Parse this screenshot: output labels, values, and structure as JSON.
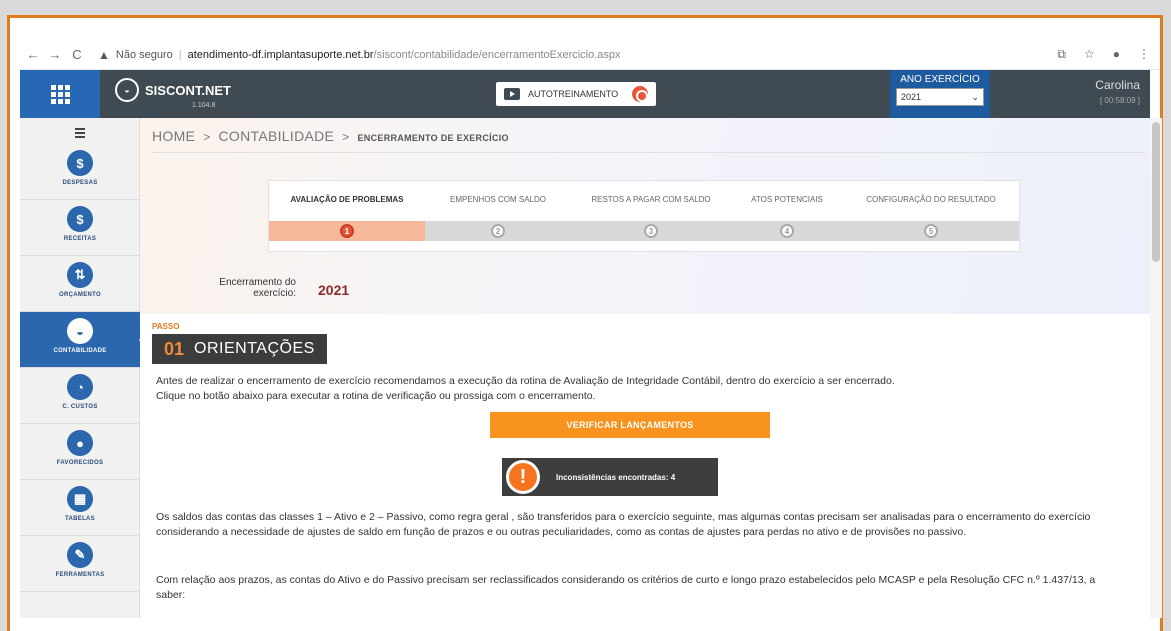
{
  "browser": {
    "security_label": "Não seguro",
    "url_host": "atendimento-df.implantasuporte.net.br",
    "url_path": "/siscont/contabilidade/encerramentoExercicio.aspx"
  },
  "topbar": {
    "app_name": "SISCONT.NET",
    "version": "1.104.8",
    "autotreinamento_label": "AUTOTREINAMENTO",
    "ano_exercicio_label": "ANO EXERCÍCIO",
    "ano_exercicio_value": "2021",
    "user_name": "Carolina",
    "session_timer": "[ 00:58:09 ]"
  },
  "sidebar": {
    "items": [
      {
        "label": "DESPESAS",
        "glyph": "$",
        "icon": "money-icon"
      },
      {
        "label": "RECEITAS",
        "glyph": "$",
        "icon": "money-icon"
      },
      {
        "label": "ORÇAMENTO",
        "glyph": "⇅",
        "icon": "transfer-icon"
      },
      {
        "label": "CONTABILIDADE",
        "glyph": "◒",
        "icon": "hand-coin-icon"
      },
      {
        "label": "C. CUSTOS",
        "glyph": "◔",
        "icon": "pie-icon"
      },
      {
        "label": "FAVORECIDOS",
        "glyph": "●",
        "icon": "user-icon"
      },
      {
        "label": "TABELAS",
        "glyph": "▦",
        "icon": "table-icon"
      },
      {
        "label": "FERRAMENTAS",
        "glyph": "✎",
        "icon": "wrench-icon"
      }
    ],
    "active_index": 3,
    "accent_color": "#2a67ad"
  },
  "breadcrumb": {
    "home": "HOME",
    "section": "CONTABILIDADE",
    "current": "ENCERRAMENTO DE EXERCÍCIO"
  },
  "stepper": {
    "steps": [
      {
        "label": "AVALIAÇÃO DE PROBLEMAS",
        "number": "1"
      },
      {
        "label": "EMPENHOS COM SALDO",
        "number": "2"
      },
      {
        "label": "RESTOS A PAGAR COM SALDO",
        "number": "3"
      },
      {
        "label": "ATOS POTENCIAIS",
        "number": "4"
      },
      {
        "label": "CONFIGURAÇÃO DO RESULTADO",
        "number": "5"
      }
    ],
    "active_index": 0
  },
  "encerramento": {
    "label_line1": "Encerramento do",
    "label_line2": "exercício:",
    "year": "2021"
  },
  "passo": {
    "label": "PASSO",
    "number": "01",
    "title": "ORIENTAÇÕES"
  },
  "text": {
    "intro_line1": "Antes de realizar o encerramento de exercício recomendamos a execução da rotina de Avaliação de Integridade Contábil, dentro do exercício a ser encerrado.",
    "intro_line2": "Clique no botão abaixo para executar a rotina de verificação ou prossiga com o encerramento.",
    "verificar_button": "VERIFICAR LANÇAMENTOS",
    "inconsistencias": "Inconsistências encontradas: 4",
    "para_saldos": "Os saldos das contas das classes 1 – Ativo e 2 – Passivo, como regra geral , são transferidos para o exercício seguinte, mas algumas contas precisam ser analisadas para o encerramento do exercício considerando a necessidade de ajustes de saldo em função de prazos e ou outras peculiaridades, como as contas de ajustes para perdas no ativo e de provisões no passivo.",
    "para_prazos": "Com relação aos prazos, as contas do Ativo e do Passivo precisam ser reclassificados considerando os critérios de curto e longo prazo estabelecidos pelo MCASP e pela Resolução CFC n.º 1.437/13, a saber:"
  },
  "colors": {
    "frame_border": "#e07c1c",
    "topbar_bg": "#3f4a52",
    "primary_blue": "#2a67ad",
    "orange_button": "#f7931e",
    "active_step": "#f6b79a",
    "year_text": "#8b2a2a"
  }
}
